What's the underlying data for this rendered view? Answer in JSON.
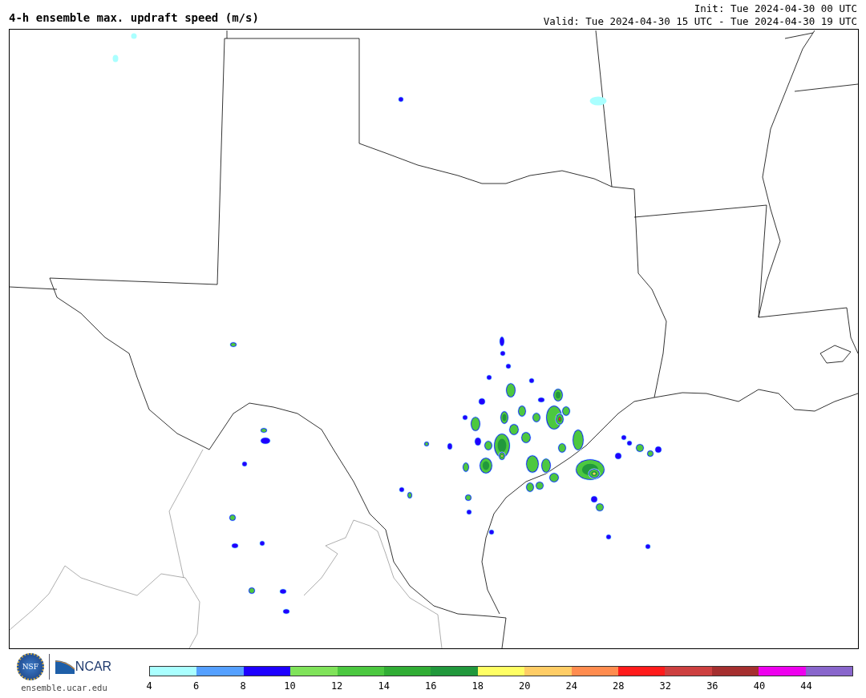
{
  "title": "4-h ensemble max. updraft speed (m/s)",
  "init": "Init: Tue 2024-04-30 00 UTC",
  "valid": "Valid: Tue 2024-04-30 15 UTC - Tue 2024-04-30 19 UTC",
  "logos": {
    "nsf_text": "NSF",
    "ncar_text": "NCAR",
    "site": "ensemble.ucar.edu"
  },
  "colorbar": [
    {
      "color": "#aaffff",
      "label": "4"
    },
    {
      "color": "#55a0ff",
      "label": "6"
    },
    {
      "color": "#1e00ff",
      "label": "8"
    },
    {
      "color": "#80e35a",
      "label": "10"
    },
    {
      "color": "#4cc840",
      "label": "12"
    },
    {
      "color": "#31ad35",
      "label": "14"
    },
    {
      "color": "#21983c",
      "label": "16"
    },
    {
      "color": "#ffff64",
      "label": "18"
    },
    {
      "color": "#ffcd66",
      "label": "20"
    },
    {
      "color": "#ff8c4f",
      "label": "24"
    },
    {
      "color": "#ff1b1b",
      "label": "28"
    },
    {
      "color": "#cd4040",
      "label": "32"
    },
    {
      "color": "#a52f2f",
      "label": "36"
    },
    {
      "color": "#ee00ee",
      "label": "40"
    },
    {
      "color": "#8966cc",
      "label": "44"
    }
  ]
}
